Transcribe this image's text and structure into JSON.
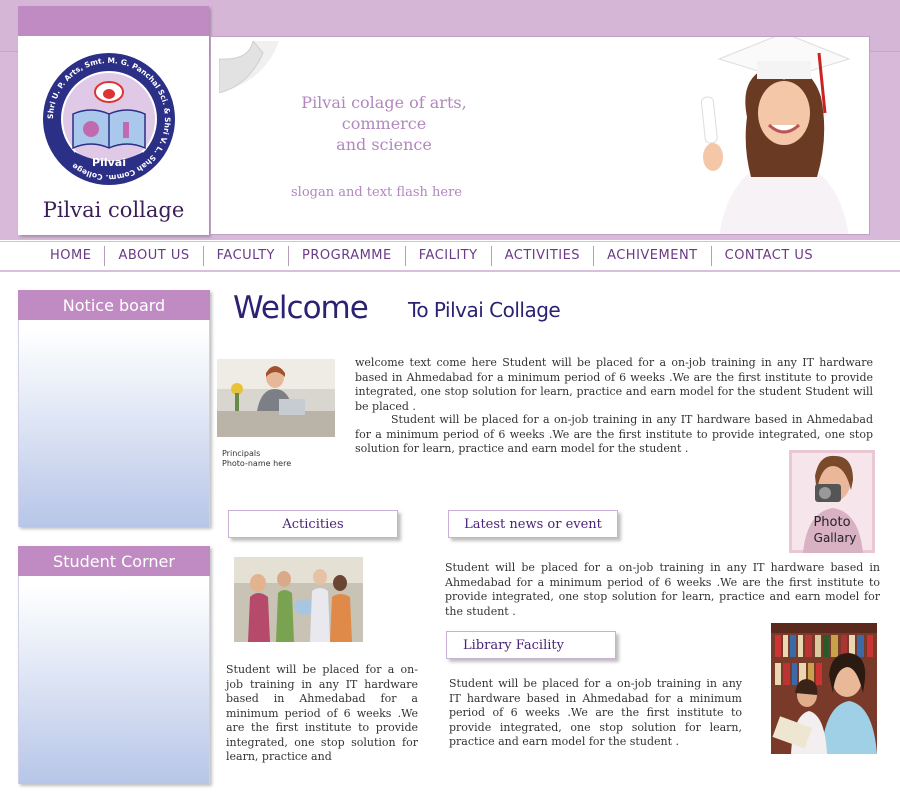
{
  "header": {
    "logo_name": "Pilvai collage",
    "seal_ring_text": "Shri U. P. Arts, Smt. M. G. Panchal Sci. & Shri V. L. Shah Comm. College",
    "seal_bottom_text": "Pilvai",
    "banner_title": "Pilvai colage of arts,\ncommerce\nand science",
    "banner_slogan": "slogan and text flash here"
  },
  "nav": {
    "items": [
      "Home",
      "About us",
      "Faculty",
      "Programme",
      "Facility",
      "Activities",
      "Achivement",
      "Contact us"
    ]
  },
  "sidebar": {
    "notice_title": "Notice board",
    "student_title": "Student Corner"
  },
  "welcome": {
    "title": "Welcome",
    "subtitle": "To Pilvai Collage"
  },
  "principal": {
    "caption_1": "Principals",
    "caption_2": "Photo-name here"
  },
  "content": {
    "para_1": "welcome text come here  Student will be placed for a on-job training in any IT hardware based in Ahmedabad for a minimum period of 6 weeks  .We are the first institute to provide integrated, one stop solution for learn, practice and earn model for the student  Student will be placed .",
    "para_2": "Student will be placed for a on-job training in any IT hardware based in Ahmedabad for a minimum period of 6 weeks  .We are the first institute to provide integrated, one stop solution for learn, practice and earn model for the student .",
    "news_text": "Student will be placed for a on-job training in any IT hardware based in Ahmedabad for a minimum period of 6 weeks  .We are the first institute to provide integrated, one stop solution for learn, practice and earn model for the student .",
    "activities_text": "Student will be placed for a on-job training in any IT hardware based in Ahmedabad for a minimum period of 6 weeks .We are the first institute to provide integrated, one stop solution for learn, practice and",
    "library_text": "Student will be placed for a on-job training in any IT hardware based in Ahmedabad for a minimum period of 6 weeks  .We are the first institute to provide integrated, one stop solution for learn, practice and earn model for the student ."
  },
  "sections": {
    "activities_label": "Acticities",
    "news_label": "Latest news or event",
    "library_label": "Library Facility"
  },
  "gallery": {
    "line_1": "Photo",
    "line_2": "Gallary"
  },
  "colors": {
    "header_band": "#d8b9d9",
    "accent_purple": "#c08bc2",
    "nav_text": "#6a3a86",
    "heading_navy": "#2a2272"
  }
}
